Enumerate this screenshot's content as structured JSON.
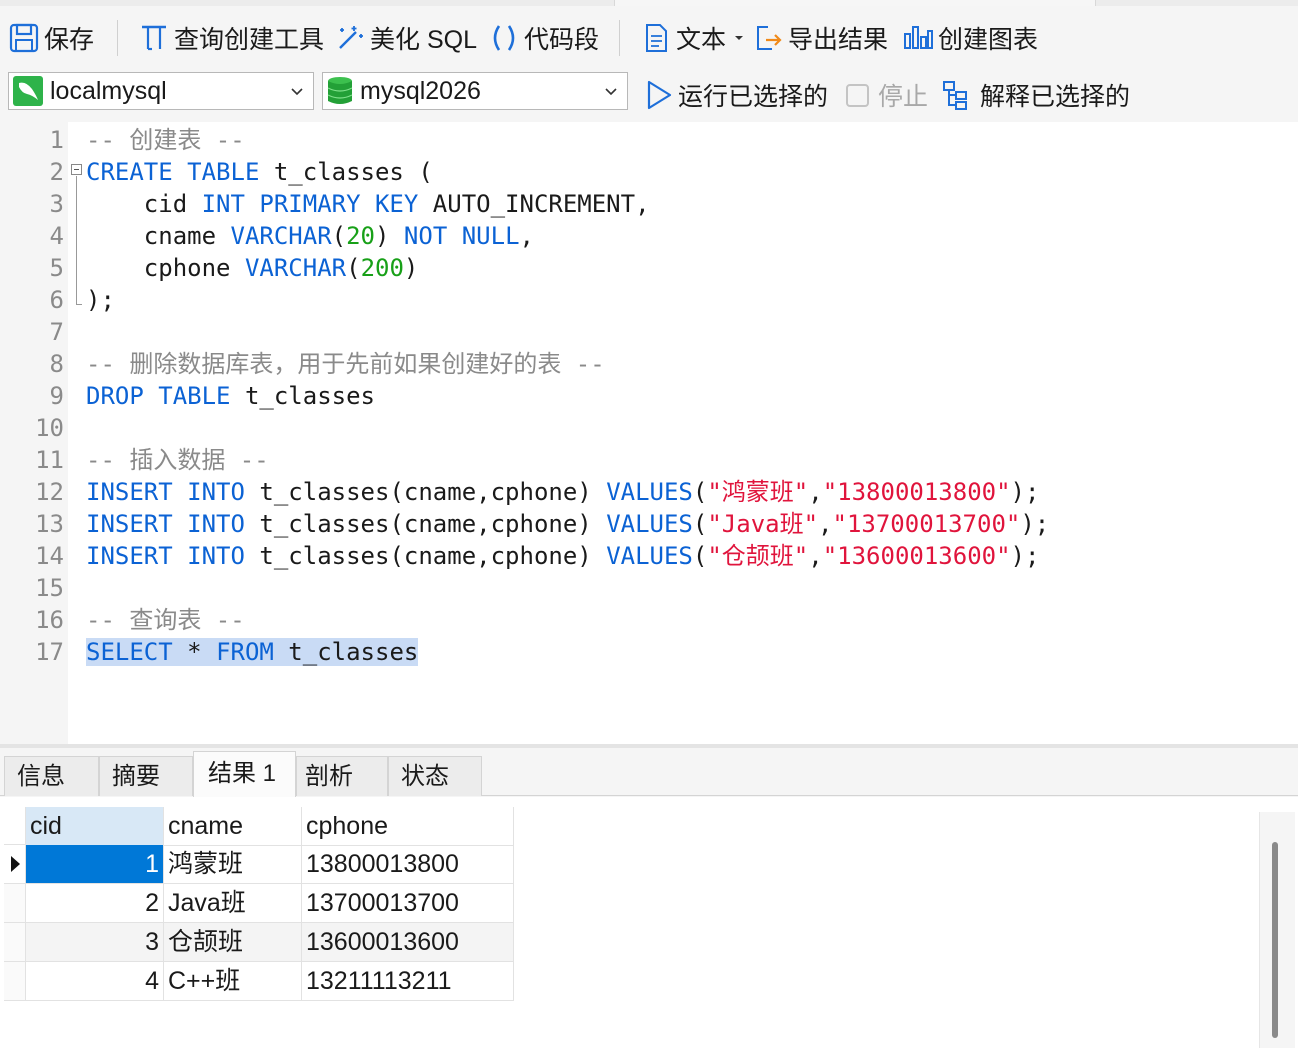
{
  "toolbar": {
    "save": "保存",
    "query_builder": "查询创建工具",
    "beautify": "美化 SQL",
    "snippet": "代码段",
    "text": "文本",
    "export": "导出结果",
    "chart": "创建图表"
  },
  "connection": {
    "server": "localmysql",
    "database": "mysql2026",
    "run_selected": "运行已选择的",
    "stop": "停止",
    "explain_selected": "解释已选择的"
  },
  "editor": {
    "line_numbers": [
      "1",
      "2",
      "3",
      "4",
      "5",
      "6",
      "7",
      "8",
      "9",
      "10",
      "11",
      "12",
      "13",
      "14",
      "15",
      "16",
      "17"
    ],
    "l1": "-- 创建表 --",
    "l2_kw": "CREATE TABLE",
    "l2_rest": " t_classes (",
    "l3_a": "    cid ",
    "l3_kw": "INT PRIMARY KEY",
    "l3_b": " AUTO_INCREMENT,",
    "l4_a": "    cname ",
    "l4_kw": "VARCHAR",
    "l4_p1": "(",
    "l4_num": "20",
    "l4_p2": ") ",
    "l4_kw2": "NOT NULL",
    "l4_end": ",",
    "l5_a": "    cphone ",
    "l5_kw": "VARCHAR",
    "l5_p1": "(",
    "l5_num": "200",
    "l5_p2": ")",
    "l6": ");",
    "l8": "-- 删除数据库表，用于先前如果创建好的表 --",
    "l9_kw": "DROP TABLE",
    "l9_rest": " t_classes",
    "l11": "-- 插入数据 --",
    "ins_kw": "INSERT INTO",
    "ins_tbl": " t_classes(cname,cphone) ",
    "ins_values": "VALUES",
    "l12_s1": "\"鸿蒙班\"",
    "l12_s2": "\"13800013800\"",
    "l13_s1": "\"Java班\"",
    "l13_s2": "\"13700013700\"",
    "l14_s1": "\"仓颉班\"",
    "l14_s2": "\"13600013600\"",
    "open_paren": "(",
    "comma": ",",
    "close_end": ");",
    "l16": "-- 查询表 --",
    "l17_kw1": "SELECT",
    "l17_mid": " * ",
    "l17_kw2": "FROM",
    "l17_rest": " t_classes"
  },
  "result_tabs": [
    "信息",
    "摘要",
    "结果 1",
    "剖析",
    "状态"
  ],
  "grid": {
    "columns": [
      "cid",
      "cname",
      "cphone"
    ],
    "rows": [
      {
        "cid": "1",
        "cname": "鸿蒙班",
        "cphone": "13800013800"
      },
      {
        "cid": "2",
        "cname": "Java班",
        "cphone": "13700013700"
      },
      {
        "cid": "3",
        "cname": "仓颉班",
        "cphone": "13600013600"
      },
      {
        "cid": "4",
        "cname": "C++班",
        "cphone": "13211113211"
      }
    ]
  },
  "colors": {
    "keyword": "#0b62d4",
    "number": "#18a018",
    "string": "#e0143c",
    "comment": "#8a8a8a",
    "selection": "#c9dbf5",
    "cell_selected": "#0078d7"
  }
}
